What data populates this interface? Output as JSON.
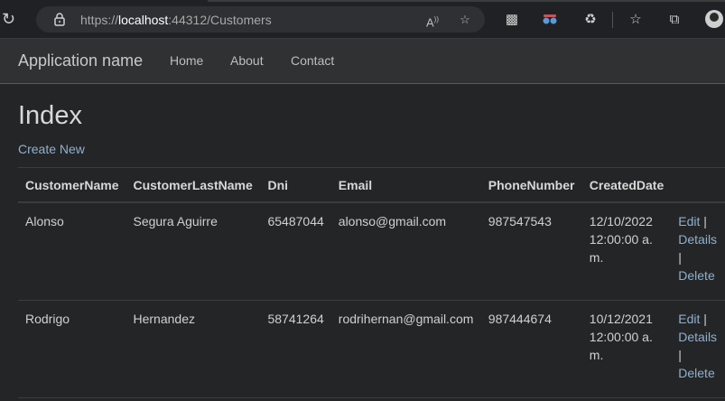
{
  "browser": {
    "url_prefix": "https://",
    "url_host": "localhost",
    "url_rest": ":44312/Customers"
  },
  "navbar": {
    "brand": "Application name",
    "links": [
      "Home",
      "About",
      "Contact"
    ]
  },
  "page": {
    "title": "Index",
    "create_link": "Create New"
  },
  "table": {
    "headers": [
      "CustomerName",
      "CustomerLastName",
      "Dni",
      "Email",
      "PhoneNumber",
      "CreatedDate"
    ],
    "rows": [
      {
        "name": "Alonso",
        "last_name": "Segura Aguirre",
        "dni": "65487044",
        "email": "alonso@gmail.com",
        "phone": "987547543",
        "created": "12/10/2022 12:00:00 a. m."
      },
      {
        "name": "Rodrigo",
        "last_name": "Hernandez",
        "dni": "58741264",
        "email": "rodrihernan@gmail.com",
        "phone": "987444674",
        "created": "10/12/2021 12:00:00 a. m."
      }
    ],
    "actions": {
      "edit": "Edit",
      "details": "Details",
      "delete": "Delete",
      "separator": "|"
    }
  },
  "icons": {
    "reload": "reload-icon",
    "lock": "lock-icon",
    "read_aloud": "read-aloud-icon",
    "favorite_add": "favorite-add-icon",
    "extension1": "extension-icon",
    "extension2": "spy-glasses-icon",
    "extensions": "puzzle-icon",
    "favorites": "favorites-icon",
    "collections": "collections-icon",
    "profile": "profile-avatar"
  },
  "colors": {
    "background": "#242526",
    "link": "#8fb0cf"
  }
}
